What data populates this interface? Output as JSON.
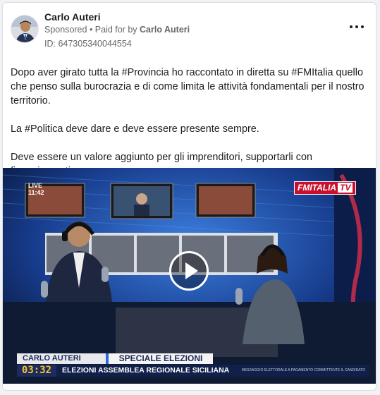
{
  "advertiser": {
    "name": "Carlo Auteri",
    "sponsored_label": "Sponsored",
    "paid_prefix": " • Paid for by ",
    "paid_by": "Carlo Auteri",
    "ad_id": "ID: 647305340044554"
  },
  "post": {
    "paragraph1": "Dopo aver girato tutta la #Provincia ho raccontato in diretta su #FMItalia quello che penso sulla burocrazia e di come limita le attività fondamentali per il nostro territorio.",
    "paragraph2": "La #Politica deve dare e deve essere presente sempre.",
    "paragraph3": "Deve essere un valore aggiunto per gli imprenditori, supportarli con finanziamenti…"
  },
  "video": {
    "channel_logo": "FMITALIA",
    "channel_logo_tv": "TV",
    "live_label": "LIVE",
    "live_time": "11:42",
    "lower_third": {
      "name": "CARLO AUTERI",
      "tag": "SPECIALE ELEZIONI",
      "time": "03:32",
      "title": "ELEZIONI ASSEMBLEA REGIONALE SICILIANA",
      "disclaimer": "MESSAGGIO ELETTORALE A PAGAMENTO COMMITTENTE IL CANDIDATO"
    },
    "play_icon": "play-icon"
  },
  "colors": {
    "text_primary": "#1c1e21",
    "text_secondary": "#65676b",
    "brand_red": "#c8102e",
    "studio_blue": "#1b4fa8"
  }
}
